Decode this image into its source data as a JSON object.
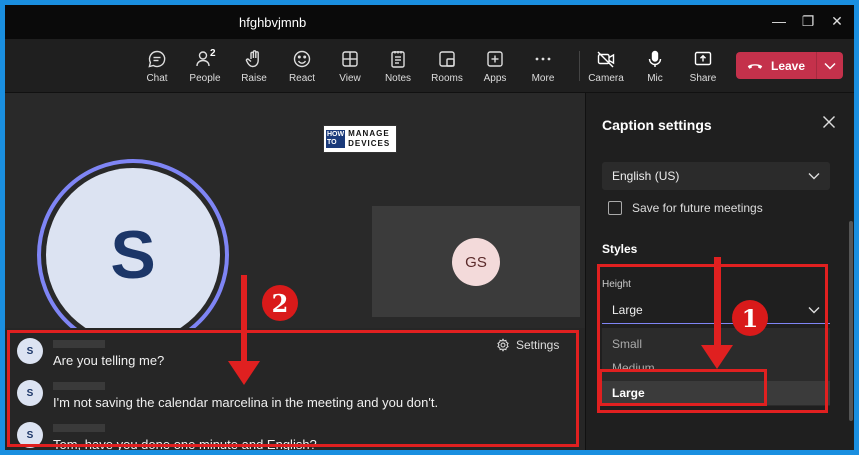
{
  "window": {
    "title": "hfghbvjmnb",
    "minimize_glyph": "—",
    "restore_glyph": "❐",
    "close_glyph": "✕"
  },
  "toolbar": {
    "chat": "Chat",
    "people": "People",
    "people_count": "2",
    "raise": "Raise",
    "react": "React",
    "view": "View",
    "notes": "Notes",
    "rooms": "Rooms",
    "apps": "Apps",
    "more": "More",
    "camera": "Camera",
    "mic": "Mic",
    "share": "Share",
    "leave": "Leave"
  },
  "stage": {
    "main_avatar_initial": "S",
    "logo_how": "HOW TO",
    "logo_text": "MANAGE DEVICES",
    "participant_initials": "GS"
  },
  "captions": {
    "settings_label": "Settings",
    "lines": [
      {
        "initial": "S",
        "text": "Are you telling me?"
      },
      {
        "initial": "S",
        "text": "I'm not saving the calendar marcelina in the meeting and you don't."
      },
      {
        "initial": "S",
        "text": "Tom, have you done one minute and English?"
      }
    ]
  },
  "panel": {
    "title": "Caption settings",
    "language": "English (US)",
    "save_label": "Save for future meetings",
    "styles_heading": "Styles",
    "height_label": "Height",
    "height_value": "Large",
    "options": [
      "Small",
      "Medium",
      "Large"
    ]
  },
  "annotations": {
    "badge_1": "1",
    "badge_2": "2"
  },
  "colors": {
    "leave": "#c4314b",
    "accent": "#7f85f5",
    "annotation": "#e02020"
  }
}
